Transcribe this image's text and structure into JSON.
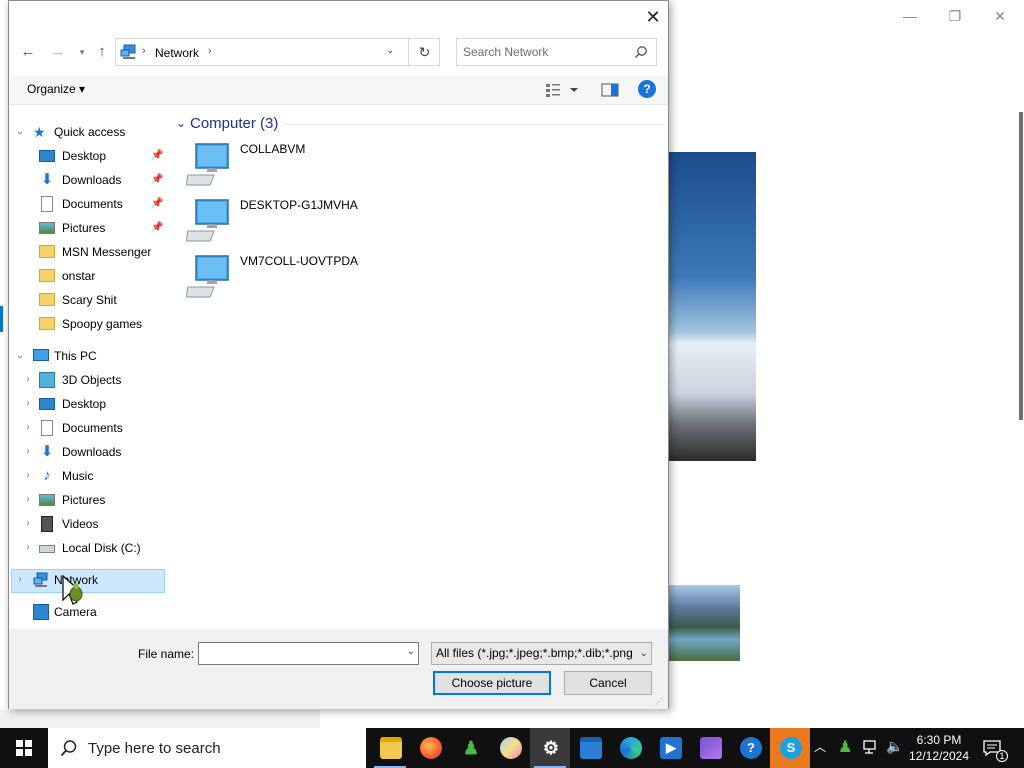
{
  "dialog": {
    "address": "Network",
    "search_placeholder": "Search Network",
    "organize": "Organize ▾"
  },
  "nav": {
    "quick_access": "Quick access",
    "quick_items": [
      "Desktop",
      "Downloads",
      "Documents",
      "Pictures",
      "MSN Messenger",
      "onstar",
      "Scary Shit",
      "Spoopy games"
    ],
    "this_pc": "This PC",
    "pc_items": [
      "3D Objects",
      "Desktop",
      "Documents",
      "Downloads",
      "Music",
      "Pictures",
      "Videos",
      "Local Disk (C:)"
    ],
    "network": "Network",
    "camera": "Camera"
  },
  "content": {
    "group_title": "Computer (3)",
    "computers": [
      "COLLABVM",
      "DESKTOP-G1JMVHA",
      "VM7COLL-UOVTPDA"
    ]
  },
  "footer": {
    "file_name_label": "File name:",
    "file_name_value": "",
    "filter": "All files (*.jpg;*.jpeg;*.bmp;*.dib;*.png",
    "choose": "Choose picture",
    "cancel": "Cancel"
  },
  "taskbar": {
    "search_placeholder": "Type here to search",
    "time": "6:30 PM",
    "date": "12/12/2024",
    "notification_count": "1"
  },
  "colors": {
    "accent": "#0078d7",
    "selection": "#cce8ff",
    "group_header": "#1e3287",
    "taskbar": "#101010"
  }
}
